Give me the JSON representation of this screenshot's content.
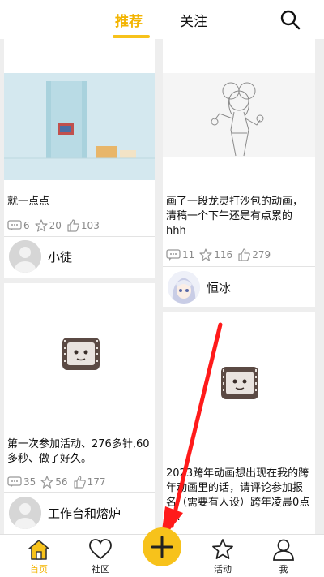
{
  "header": {
    "tabs": [
      {
        "label": "推荐",
        "active": true
      },
      {
        "label": "关注",
        "active": false
      }
    ],
    "search_icon": "search-icon",
    "accent_color": "#f7c21b"
  },
  "feed": {
    "cards": [
      {
        "description": "就一点点",
        "comments": "6",
        "favorites": "20",
        "likes": "103",
        "author": "小徒",
        "thumb": "blue-room-animation"
      },
      {
        "description": "画了一段龙灵打沙包的动画，清稿一个下午还是有点累的hhh",
        "comments": "11",
        "favorites": "116",
        "likes": "279",
        "author": "恒冰",
        "thumb": "anime-girl-sketch"
      },
      {
        "description": "第一次参加活动、276多针,60多秒、做了好久。",
        "comments": "35",
        "favorites": "56",
        "likes": "177",
        "author": "工作台和熔炉",
        "thumb": "film-reel-placeholder"
      },
      {
        "description": "2023跨年动画想出现在我的跨年动画里的话，请评论参加报名（需要有人设）跨年凌晨0点发!",
        "thumb": "film-reel-placeholder"
      }
    ]
  },
  "bottom_nav": {
    "items": [
      {
        "label": "首页",
        "icon": "home-icon",
        "active": true
      },
      {
        "label": "社区",
        "icon": "heart-icon",
        "active": false
      },
      {
        "label": "活动",
        "icon": "star-icon",
        "active": false
      },
      {
        "label": "我",
        "icon": "user-icon",
        "active": false
      }
    ],
    "create_icon": "plus-icon"
  },
  "annotation": {
    "color": "#ff1a1a"
  }
}
